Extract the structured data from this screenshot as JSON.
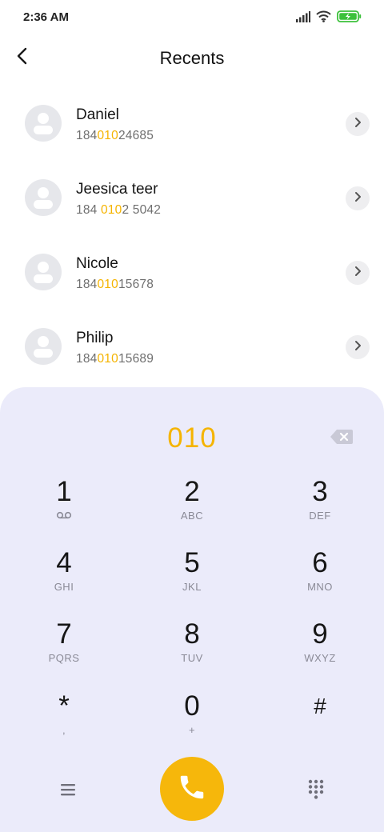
{
  "status_bar": {
    "time": "2:36 AM",
    "icons": [
      "signal-icon",
      "wifi-icon",
      "battery-charging-icon"
    ],
    "battery_color": "#3cc13b"
  },
  "header": {
    "title": "Recents",
    "back_icon": "chevron-left-icon"
  },
  "contacts": [
    {
      "name": "Daniel",
      "number_pre": "184",
      "number_match": "010",
      "number_post": "24685"
    },
    {
      "name": "Jeesica teer",
      "number_pre": "184 ",
      "number_match": "010",
      "number_post": "2 5042"
    },
    {
      "name": "Nicole",
      "number_pre": "184",
      "number_match": "010",
      "number_post": "15678"
    },
    {
      "name": "Philip",
      "number_pre": "184",
      "number_match": "010",
      "number_post": "15689"
    }
  ],
  "dialpad": {
    "entered": "010",
    "accent_color": "#f5b400",
    "keys": [
      {
        "digit": "1",
        "letters": "",
        "icon": "voicemail-icon"
      },
      {
        "digit": "2",
        "letters": "ABC"
      },
      {
        "digit": "3",
        "letters": "DEF"
      },
      {
        "digit": "4",
        "letters": "GHI"
      },
      {
        "digit": "5",
        "letters": "JKL"
      },
      {
        "digit": "6",
        "letters": "MNO"
      },
      {
        "digit": "7",
        "letters": "PQRS"
      },
      {
        "digit": "8",
        "letters": "TUV"
      },
      {
        "digit": "9",
        "letters": "WXYZ"
      },
      {
        "digit": "*",
        "letters": ","
      },
      {
        "digit": "0",
        "letters": "+"
      },
      {
        "digit": "#",
        "letters": ""
      }
    ]
  },
  "bottom_bar": {
    "menu_icon": "menu-icon",
    "call_icon": "phone-icon",
    "keypad_icon": "keypad-grid-icon",
    "call_color": "#f6b70b"
  }
}
